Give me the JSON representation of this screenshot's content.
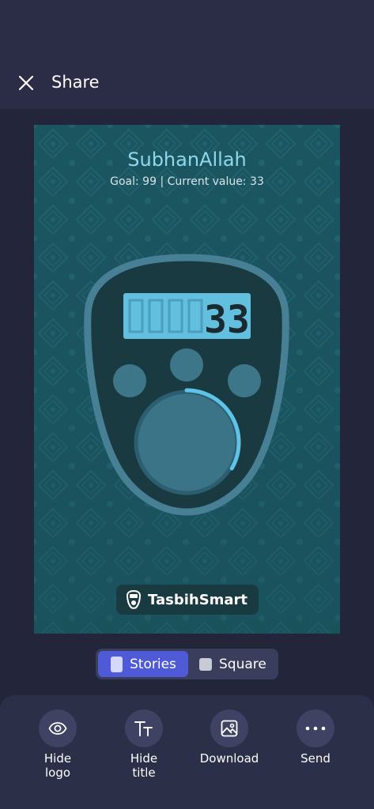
{
  "header": {
    "title": "Share"
  },
  "card": {
    "title": "SubhanAllah",
    "subtitle": "Goal: 99  |  Current value: 33",
    "counter": {
      "goal": 99,
      "value": 33,
      "display_digits": "33"
    },
    "brand": "TasbihSmart"
  },
  "format_toggle": {
    "options": [
      {
        "label": "Stories",
        "selected": true
      },
      {
        "label": "Square",
        "selected": false
      }
    ]
  },
  "actions": [
    {
      "label": "Hide\nlogo",
      "icon": "eye-icon"
    },
    {
      "label": "Hide\ntitle",
      "icon": "text-icon"
    },
    {
      "label": "Download",
      "icon": "image-icon"
    },
    {
      "label": "Send",
      "icon": "more-dots-icon"
    }
  ],
  "colors": {
    "background": "#23253a",
    "accent": "#4f5ad6",
    "card_background": "#1b5560",
    "counter_highlight": "#5ec3e8"
  }
}
